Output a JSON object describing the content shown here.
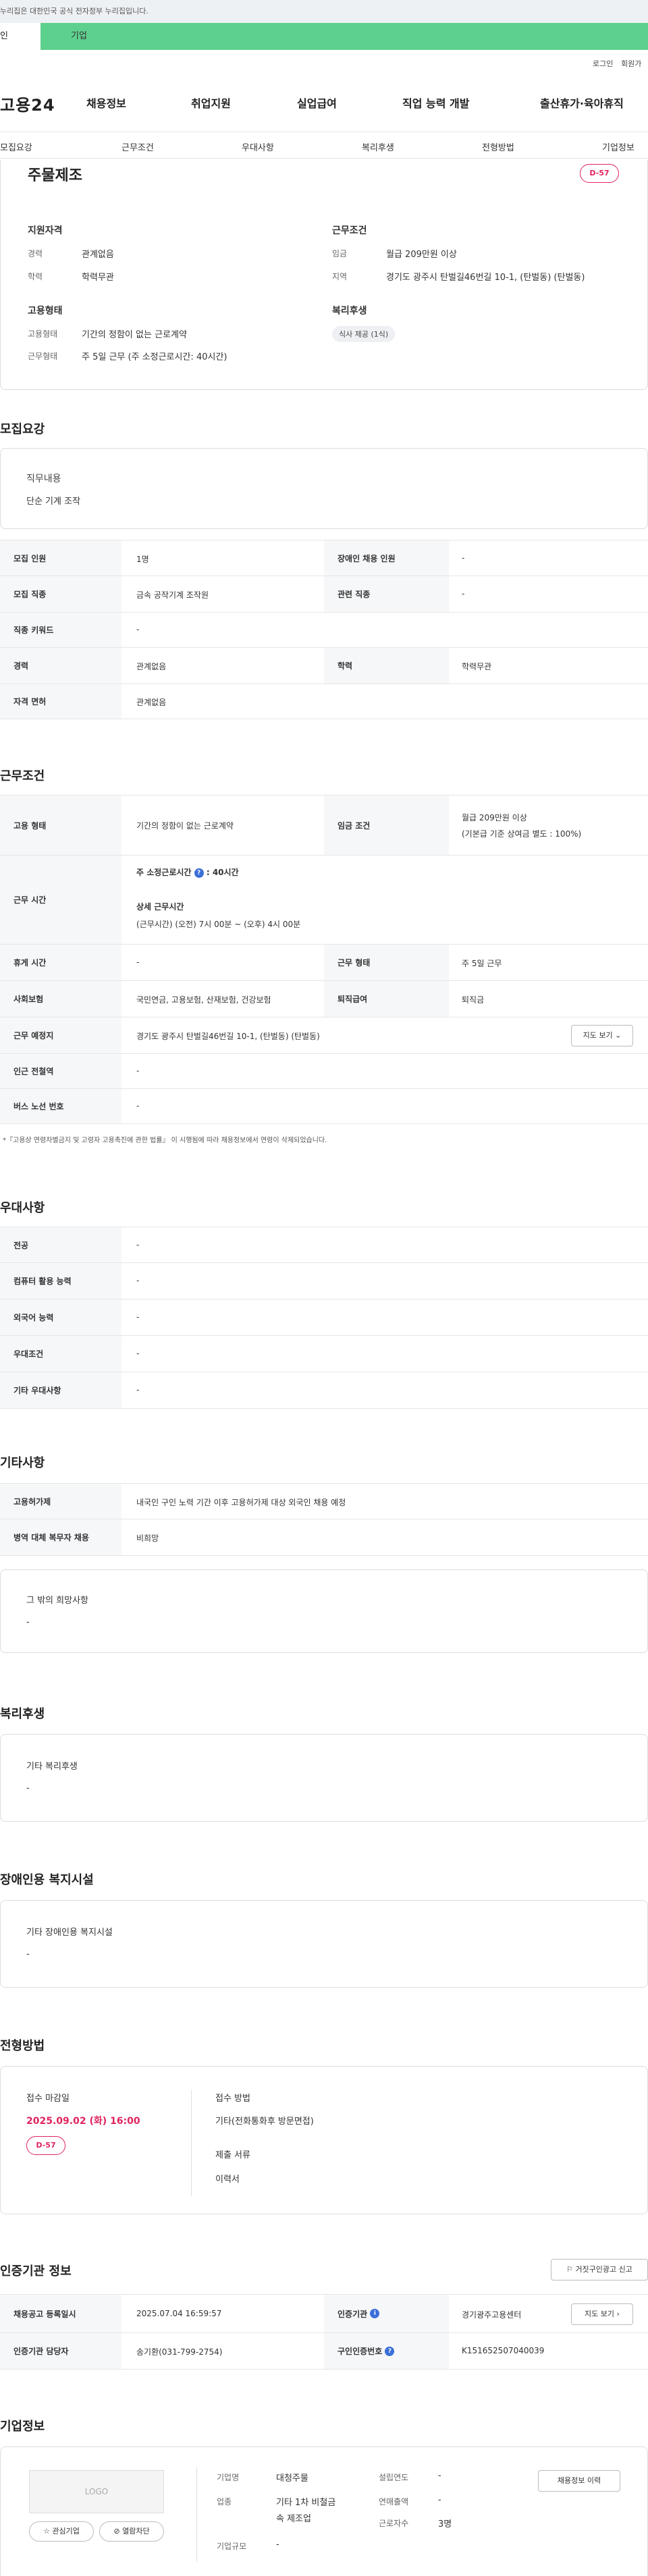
{
  "topbar": {
    "notice": "누리집은 대한민국 공식 전자정부 누리집입니다."
  },
  "tabs": {
    "person": "인",
    "company": "기업"
  },
  "util": {
    "login": "로그인",
    "join": "회원가"
  },
  "logo": "고용24",
  "gnb": [
    "채용정보",
    "취업지원",
    "실업급여",
    "직업 능력 개발",
    "출산휴가·육아휴직"
  ],
  "subnav": [
    "모집요강",
    "근무조건",
    "우대사항",
    "복리후생",
    "전형방법",
    "기업정보"
  ],
  "summary": {
    "title": "주물제조",
    "dday": "D-57",
    "qual_head": "지원자격",
    "exp_label": "경력",
    "exp_val": "관계없음",
    "edu_label": "학력",
    "edu_val": "학력무관",
    "cond_head": "근무조건",
    "wage_label": "임금",
    "wage_val": "월급 209만원 이상",
    "loc_label": "지역",
    "loc_val": "경기도 광주시 탄벌길46번길 10-1, (탄벌동) (탄벌동)",
    "emp_head": "고용형태",
    "type_label": "고용형태",
    "type_val": "기간의 정함이 없는 근로계약",
    "form_label": "근무형태",
    "form_val": "주 5일 근무 (주 소정근로시간: 40시간)",
    "welfare_head": "복리후생",
    "welfare_chip": "식사 제공 (1식)"
  },
  "recruit": {
    "title": "모집요강",
    "duty_head": "직무내용",
    "duty_val": "단순 기계 조작",
    "r1": {
      "h1": "모집 인원",
      "v1": "1명",
      "h2": "장애인 채용 인원",
      "v2": "-"
    },
    "r2": {
      "h1": "모집 직종",
      "v1": "금속 공작기계 조작원",
      "h2": "관련 직종",
      "v2": "-"
    },
    "r3": {
      "h1": "직종 키워드",
      "v1": "-"
    },
    "r4": {
      "h1": "경력",
      "v1": "관계없음",
      "h2": "학력",
      "v2": "학력무관"
    },
    "r5": {
      "h1": "자격 면허",
      "v1": "관계없음"
    }
  },
  "work": {
    "title": "근무조건",
    "r1": {
      "h1": "고용 형태",
      "v1": "기간의 정함이 없는 근로계약",
      "h2": "임금 조건",
      "v2a": "월급 209만원 이상",
      "v2b": "(기본급 기준 상여금 별도 : 100%)"
    },
    "r2": {
      "h1": "근무 시간",
      "a": "주 소정근로시간",
      "q": "?",
      "b": ": 40시간",
      "c": "상세 근무시간",
      "d": "(근무시간) (오전) 7시 00분 ~ (오후) 4시 00분"
    },
    "r3": {
      "h1": "휴게 시간",
      "v1": "-",
      "h2": "근무 형태",
      "v2": "주 5일 근무"
    },
    "r4": {
      "h1": "사회보험",
      "v1": "국민연금, 고용보험, 산재보험, 건강보험",
      "h2": "퇴직급여",
      "v2": "퇴직금"
    },
    "r5": {
      "h1": "근무 예정지",
      "v1": "경기도 광주시 탄벌길46번길 10-1, (탄벌동) (탄벌동)",
      "btn": "지도 보기 ⌄"
    },
    "r6": {
      "h1": "인근 전철역",
      "v1": "-"
    },
    "r7": {
      "h1": "버스 노선 번호",
      "v1": "-"
    },
    "note": "*『고용상 연령차별금지 및 고령자 고용촉진에 관한 법률』 이 시행됨에 따라 채용정보에서 연령이 삭제되었습니다."
  },
  "pref": {
    "title": "우대사항",
    "rows": [
      {
        "h": "전공",
        "v": "-"
      },
      {
        "h": "컴퓨터 활용 능력",
        "v": "-"
      },
      {
        "h": "외국어 능력",
        "v": "-"
      },
      {
        "h": "우대조건",
        "v": "-"
      },
      {
        "h": "기타 우대사항",
        "v": "-"
      }
    ]
  },
  "etc": {
    "title": "기타사항",
    "rows": [
      {
        "h": "고용허가제",
        "v": "내국인 구인 노력 기간 이후 고용허가제 대상 외국인 채용 예정"
      },
      {
        "h": "병역 대체 복무자 채용",
        "v": "비희망"
      }
    ],
    "other_head": "그 밖의 희망사항",
    "other_val": "-"
  },
  "welfare": {
    "title": "복리후생",
    "head": "기타 복리후생",
    "val": "-"
  },
  "disabled": {
    "title": "장애인용 복지시설",
    "head": "기타 장애인용 복지시설",
    "val": "-"
  },
  "selection": {
    "title": "전형방법",
    "deadline_head": "접수 마감일",
    "deadline": "2025.09.02 (화) 16:00",
    "dday": "D-57",
    "method_head": "접수 방법",
    "method_val": "기타(전화통화후 방문면접)",
    "docs_head": "제출 서류",
    "docs_val": "이력서"
  },
  "agency": {
    "title": "인증기관 정보",
    "report_btn": "거짓구인광고 신고",
    "r1": {
      "h1": "채용공고 등록일시",
      "v1": "2025.07.04 16:59:57",
      "h2": "인증기관",
      "v2": "경기광주고용센터",
      "btn": "지도 보기"
    },
    "r2": {
      "h1": "인증기관 담당자",
      "v1": "송기환(031-799-2754)",
      "h2": "구인인증번호",
      "v2": "K151652507040039"
    }
  },
  "company": {
    "title": "기업정보",
    "logo": "LOGO",
    "fav": "☆ 관심기업",
    "block": "열람차단",
    "name_h": "기업명",
    "name_v": "대청주물",
    "ind_h": "업종",
    "ind_v1": "기타 1차 비철금",
    "ind_v2": "속 제조업",
    "size_h": "기업규모",
    "size_v": "-",
    "est_h": "설립연도",
    "est_v": "-",
    "sales_h": "연매출액",
    "sales_v": "-",
    "emp_h": "근로자수",
    "emp_v": "3명",
    "history_btn": "채용정보 이력"
  }
}
